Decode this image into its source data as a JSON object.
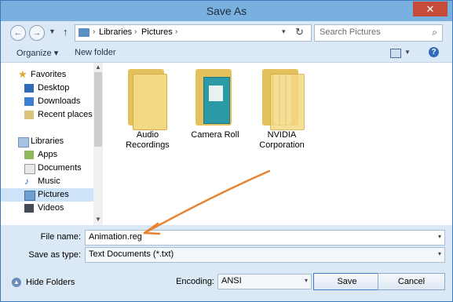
{
  "window": {
    "title": "Save As",
    "close_glyph": "✕"
  },
  "nav": {
    "back_glyph": "←",
    "forward_glyph": "→",
    "recent_glyph": "▼",
    "up_glyph": "↑",
    "breadcrumb": [
      "Libraries",
      "Pictures"
    ],
    "separator_glyph": "›",
    "dropdown_glyph": "▾",
    "refresh_glyph": "↻",
    "search_placeholder": "Search Pictures",
    "search_glyph": "⌕"
  },
  "toolbar": {
    "organize": "Organize ▾",
    "new_folder": "New folder",
    "view_drop_glyph": "▼",
    "help_glyph": "?"
  },
  "sidebar": {
    "scroll_up_glyph": "▲",
    "scroll_down_glyph": "▼",
    "favorites": {
      "label": "Favorites",
      "items": [
        "Desktop",
        "Downloads",
        "Recent places"
      ]
    },
    "libraries": {
      "label": "Libraries",
      "items": [
        "Apps",
        "Documents",
        "Music",
        "Pictures",
        "Videos"
      ],
      "selected": "Pictures"
    }
  },
  "folders": [
    {
      "line1": "Audio",
      "line2": "Recordings"
    },
    {
      "line1": "Camera Roll",
      "line2": ""
    },
    {
      "line1": "NVIDIA",
      "line2": "Corporation"
    }
  ],
  "form": {
    "file_name_label": "File name:",
    "file_name_label_underline_char": "n",
    "file_name_value": "Animation.reg",
    "save_type_label": "Save as type:",
    "save_type_value": "Text Documents (*.txt)",
    "dropdown_glyph": "▾",
    "encoding_label": "Encoding:",
    "encoding_value": "ANSI"
  },
  "footer": {
    "hide_folders": "Hide Folders",
    "hide_glyph": "▲",
    "save": "Save",
    "cancel": "Cancel"
  },
  "colors": {
    "annotation_arrow": "#e8822f",
    "selected_item": "#cde3f8",
    "title_bar": "#7ab0e0"
  }
}
